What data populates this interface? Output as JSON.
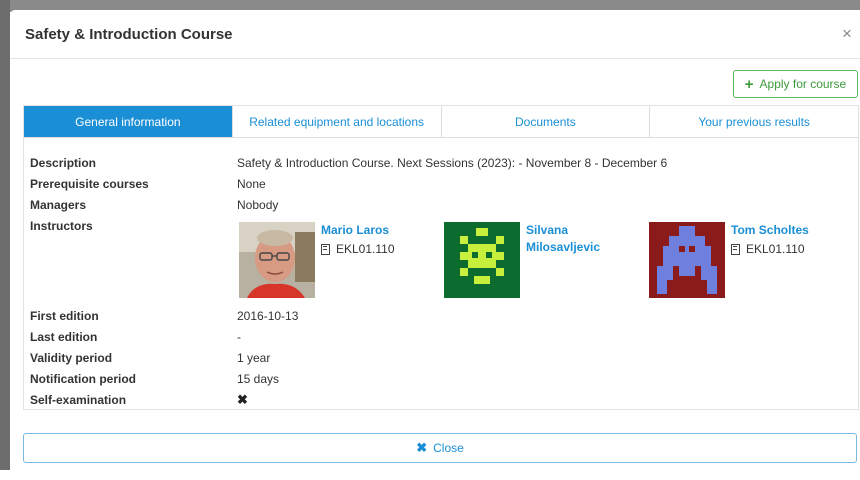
{
  "modal": {
    "title": "Safety & Introduction Course",
    "close_symbol": "×",
    "apply_label": "Apply for course",
    "close_label": "Close"
  },
  "tabs": [
    {
      "label": "General information",
      "active": true
    },
    {
      "label": "Related equipment and locations",
      "active": false
    },
    {
      "label": "Documents",
      "active": false
    },
    {
      "label": "Your previous results",
      "active": false
    }
  ],
  "details": {
    "description_label": "Description",
    "description_value": "Safety & Introduction Course. Next Sessions (2023): - November 8 - December 6",
    "prereq_label": "Prerequisite courses",
    "prereq_value": "None",
    "managers_label": "Managers",
    "managers_value": "Nobody",
    "instructors_label": "Instructors",
    "first_edition_label": "First edition",
    "first_edition_value": "2016-10-13",
    "last_edition_label": "Last edition",
    "last_edition_value": "-",
    "validity_label": "Validity period",
    "validity_value": "1 year",
    "notification_label": "Notification period",
    "notification_value": "15 days",
    "self_exam_label": "Self-examination",
    "self_exam_value": "✖"
  },
  "instructors": [
    {
      "name": "Mario Laros",
      "room": "EKL01.110",
      "avatar": "photo"
    },
    {
      "name": "Silvana Milosavljevic",
      "room": "",
      "avatar": "identicon-green"
    },
    {
      "name": "Tom Scholtes",
      "room": "EKL01.110",
      "avatar": "identicon-red-blue"
    }
  ],
  "colors": {
    "primary": "#1a8fd6",
    "success": "#5cb85c",
    "identicon_green_bg": "#0c6b2e",
    "identicon_green_fg": "#c7ef3c",
    "identicon_red_bg": "#8b1a1a",
    "identicon_blue_fg": "#6f7fdd"
  }
}
